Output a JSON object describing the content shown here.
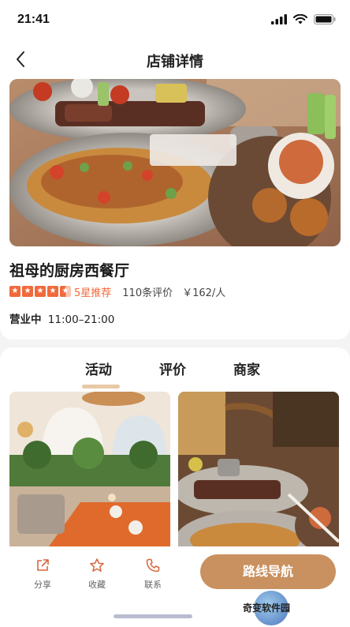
{
  "status_bar": {
    "time": "21:41"
  },
  "nav": {
    "title": "店铺详情"
  },
  "shop": {
    "name": "祖母的厨房西餐厅",
    "rating_stars": 4.5,
    "rating_label": "5星推荐",
    "review_count": "110条评价",
    "price": "￥162/人",
    "business_status": "营业中",
    "hours": "11:00–21:00"
  },
  "tabs": [
    {
      "label": "活动",
      "active": true
    },
    {
      "label": "评价",
      "active": false
    },
    {
      "label": "商家",
      "active": false
    }
  ],
  "bottom_bar": {
    "share_label": "分享",
    "favorite_label": "收藏",
    "contact_label": "联系",
    "navigate_label": "路线导航"
  },
  "watermark": {
    "text": "奇变软件园"
  },
  "colors": {
    "accent": "#c9915f",
    "star": "#f06a3c",
    "tab_underline": "#e9c9a5"
  }
}
